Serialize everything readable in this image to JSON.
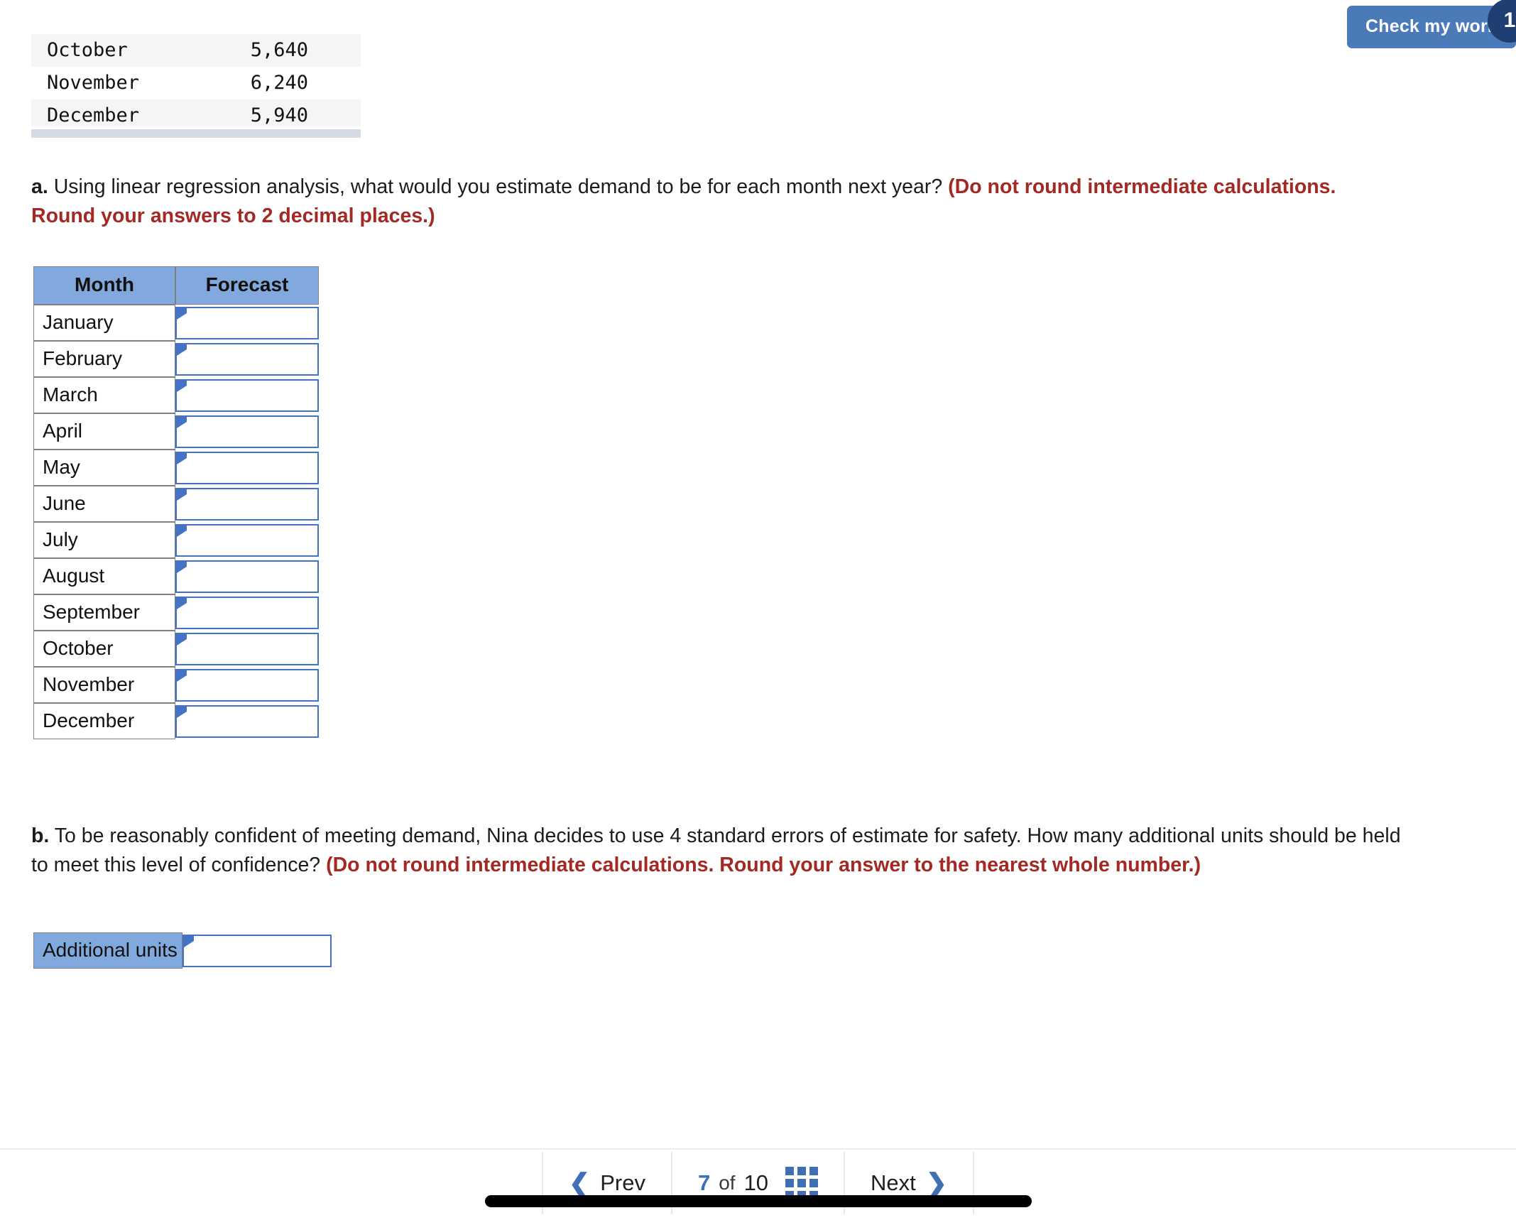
{
  "toolbar": {
    "check_work_label": "Check my work",
    "check_work_badge": "1",
    "accent_blue": "#4a7ab8",
    "badge_navy": "#1f3f73"
  },
  "demand_table": {
    "rows": [
      {
        "month": "October",
        "value": "5,640",
        "clipped": true
      },
      {
        "month": "November",
        "value": "6,240",
        "clipped": false
      },
      {
        "month": "December",
        "value": "5,940",
        "clipped": false
      }
    ]
  },
  "questions": {
    "a": {
      "label": "a.",
      "prompt": "Using linear regression analysis, what would you estimate demand to be for each month next year?",
      "hint": "(Do not round intermediate calculations. Round your answers to 2 decimal places.)"
    },
    "b": {
      "label": "b.",
      "prompt": "To be reasonably confident of meeting demand, Nina decides to use 4 standard errors of estimate for safety. How many additional units should be held to meet this level of confidence?",
      "hint": "(Do not round intermediate calculations. Round your answer to the nearest whole number.)"
    }
  },
  "forecast_table": {
    "headers": [
      "Month",
      "Forecast"
    ],
    "header_bg": "#82a9dd",
    "input_border": "#4472c4",
    "rows": [
      {
        "month": "January",
        "forecast": ""
      },
      {
        "month": "February",
        "forecast": ""
      },
      {
        "month": "March",
        "forecast": ""
      },
      {
        "month": "April",
        "forecast": ""
      },
      {
        "month": "May",
        "forecast": ""
      },
      {
        "month": "June",
        "forecast": ""
      },
      {
        "month": "July",
        "forecast": ""
      },
      {
        "month": "August",
        "forecast": ""
      },
      {
        "month": "September",
        "forecast": ""
      },
      {
        "month": "October",
        "forecast": ""
      },
      {
        "month": "November",
        "forecast": ""
      },
      {
        "month": "December",
        "forecast": ""
      }
    ]
  },
  "units_table": {
    "label": "Additional units",
    "value": ""
  },
  "pagination": {
    "prev_label": "Prev",
    "next_label": "Next",
    "current_page": "7",
    "of_label": "of",
    "total_pages": "10",
    "grid_icon": "grid-3x3-icon",
    "accent": "#3f6fb5"
  }
}
